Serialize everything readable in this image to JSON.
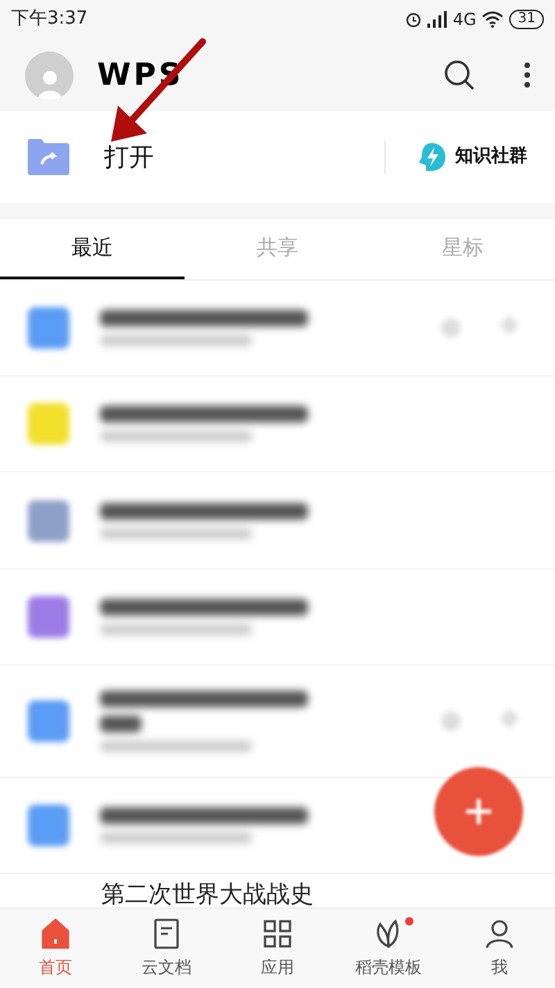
{
  "status_bar": {
    "time": "下午3:37",
    "network": "4G",
    "battery": "31"
  },
  "header": {
    "logo": "WPS"
  },
  "quick": {
    "open": "打开",
    "community": "知识社群"
  },
  "tabs": [
    {
      "label": "最近",
      "selected": true
    },
    {
      "label": "共享",
      "selected": false
    },
    {
      "label": "星标",
      "selected": false
    }
  ],
  "files": [
    {
      "color": "#5b9cf5",
      "title_wraps": false,
      "actions": true
    },
    {
      "color": "#f2e02c",
      "title_wraps": false,
      "actions": false
    },
    {
      "color": "#8fa0c8",
      "title_wraps": false,
      "actions": false
    },
    {
      "color": "#9b7ce6",
      "title_wraps": false,
      "actions": false
    },
    {
      "color": "#5b9cf5",
      "title_wraps": true,
      "actions": true
    },
    {
      "color": "#5b9cf5",
      "title_wraps": false,
      "actions": false
    }
  ],
  "partial_row": "第二次世界大战战史",
  "nav": [
    {
      "label": "首页",
      "selected": true,
      "badge": false
    },
    {
      "label": "云文档",
      "selected": false,
      "badge": false
    },
    {
      "label": "应用",
      "selected": false,
      "badge": false
    },
    {
      "label": "稻壳模板",
      "selected": false,
      "badge": true
    },
    {
      "label": "我",
      "selected": false,
      "badge": false
    }
  ]
}
